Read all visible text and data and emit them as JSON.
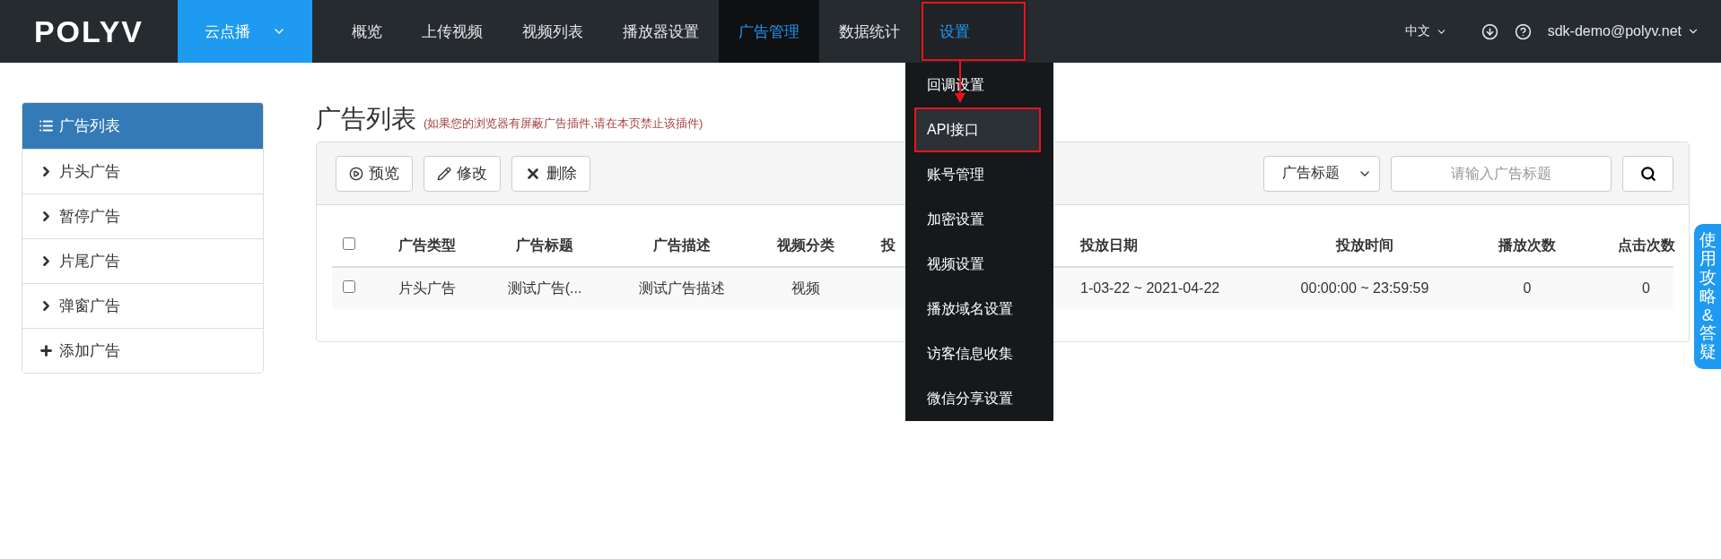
{
  "logo": "POLYV",
  "product_switch": {
    "label": "云点播",
    "selected": true
  },
  "nav": [
    {
      "label": "概览",
      "selected": false,
      "annotated": false
    },
    {
      "label": "上传视频",
      "selected": false,
      "annotated": false
    },
    {
      "label": "视频列表",
      "selected": false,
      "annotated": false
    },
    {
      "label": "播放器设置",
      "selected": false,
      "annotated": false
    },
    {
      "label": "广告管理",
      "selected": true,
      "annotated": false
    },
    {
      "label": "数据统计",
      "selected": false,
      "annotated": false
    },
    {
      "label": "设置",
      "selected": false,
      "annotated": true,
      "open": true
    }
  ],
  "dropdown": [
    {
      "label": "回调设置",
      "highlighted": false,
      "annotated": false
    },
    {
      "label": "API接口",
      "highlighted": true,
      "annotated": true
    },
    {
      "label": "账号管理",
      "highlighted": false,
      "annotated": false
    },
    {
      "label": "加密设置",
      "highlighted": false,
      "annotated": false
    },
    {
      "label": "视频设置",
      "highlighted": false,
      "annotated": false
    },
    {
      "label": "播放域名设置",
      "highlighted": false,
      "annotated": false
    },
    {
      "label": "访客信息收集",
      "highlighted": false,
      "annotated": false
    },
    {
      "label": "微信分享设置",
      "highlighted": false,
      "annotated": false
    }
  ],
  "header_right": {
    "language": "中文",
    "user": "sdk-demo@polyv.net"
  },
  "sidebar": [
    {
      "label": "广告列表",
      "kind": "list",
      "selected": true
    },
    {
      "label": "片头广告",
      "kind": "link",
      "selected": false
    },
    {
      "label": "暂停广告",
      "kind": "link",
      "selected": false
    },
    {
      "label": "片尾广告",
      "kind": "link",
      "selected": false
    },
    {
      "label": "弹窗广告",
      "kind": "link",
      "selected": false
    },
    {
      "label": "添加广告",
      "kind": "add",
      "selected": false
    }
  ],
  "page_title": "广告列表",
  "page_hint": "(如果您的浏览器有屏蔽广告插件,请在本页禁止该插件)",
  "toolbar": [
    {
      "label": "预览",
      "kind": "preview"
    },
    {
      "label": "修改",
      "kind": "edit"
    },
    {
      "label": "删除",
      "kind": "delete"
    }
  ],
  "search": {
    "filter": "广告标题",
    "placeholder": "请输入广告标题"
  },
  "table": {
    "header_checked": false,
    "columns": [
      "广告类型",
      "广告标题",
      "广告描述",
      "视频分类",
      "投",
      "投放日期",
      "投放时间",
      "播放次数",
      "点击次数"
    ],
    "rows": [
      {
        "checked": false,
        "cells": [
          "片头广告",
          "测试广告(...",
          "测试广告描述",
          "视频",
          "",
          "1-03-22 ~ 2021-04-22",
          "00:00:00 ~ 23:59:59",
          "0",
          "0"
        ]
      }
    ]
  },
  "help_tab": "使用攻略&答疑"
}
